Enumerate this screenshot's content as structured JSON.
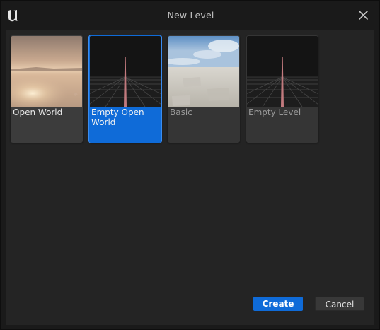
{
  "window": {
    "title": "New Level",
    "icons": {
      "logo": "unreal-engine-logo",
      "close": "close-icon"
    }
  },
  "templates": [
    {
      "label": "Open World",
      "thumbnail": "open-world-sunset",
      "selected": false
    },
    {
      "label": "Empty Open World",
      "thumbnail": "empty-grid",
      "selected": true
    },
    {
      "label": "Basic",
      "thumbnail": "basic-sky-floor",
      "selected": false
    },
    {
      "label": "Empty Level",
      "thumbnail": "empty-grid",
      "selected": false
    }
  ],
  "buttons": {
    "create": "Create",
    "cancel": "Cancel"
  },
  "colors": {
    "accent": "#0f6bd8",
    "background": "#242424",
    "titlebar": "#1a1a1a"
  }
}
